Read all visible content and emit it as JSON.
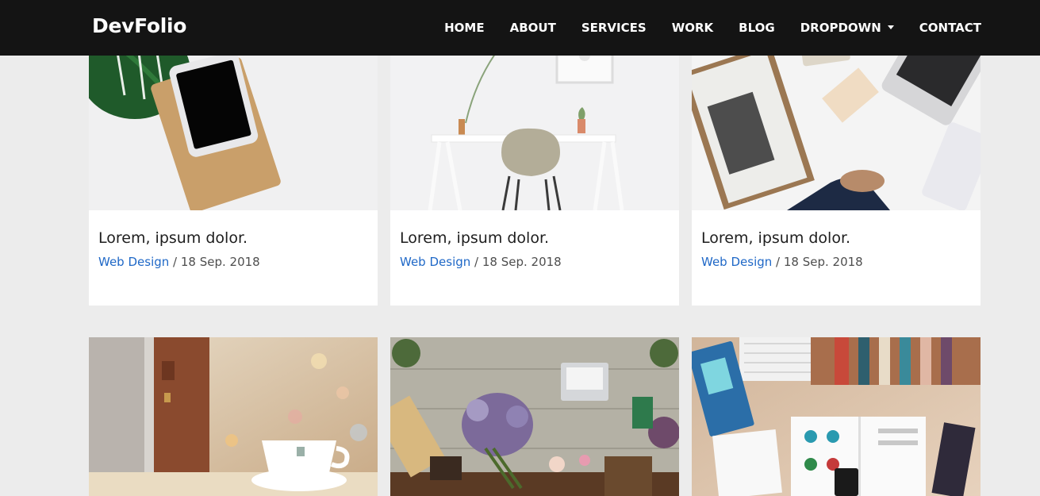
{
  "brand": "DevFolio",
  "nav": {
    "home": "HOME",
    "about": "ABOUT",
    "services": "SERVICES",
    "work": "WORK",
    "blog": "BLOG",
    "dropdown": "DROPDOWN",
    "contact": "CONTACT"
  },
  "portfolio": [
    {
      "title": "Lorem, ipsum dolor.",
      "category": "Web Design",
      "date": "18 Sep. 2018",
      "separator": "/"
    },
    {
      "title": "Lorem, ipsum dolor.",
      "category": "Web Design",
      "date": "18 Sep. 2018",
      "separator": "/"
    },
    {
      "title": "Lorem, ipsum dolor.",
      "category": "Web Design",
      "date": "18 Sep. 2018",
      "separator": "/"
    }
  ],
  "colors": {
    "navbar": "#141414",
    "link": "#1f68c7",
    "background": "#ececec"
  }
}
